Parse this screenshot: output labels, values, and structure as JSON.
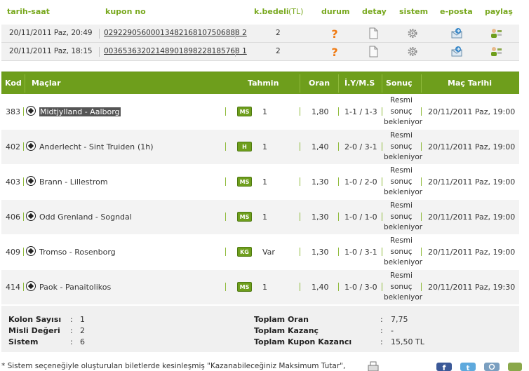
{
  "coupons": {
    "headers": {
      "datetime": "tarih-saat",
      "coupon_no": "kupon no",
      "stake": "k.bedeli",
      "currency": "(TL)",
      "status": "durum",
      "detail": "detay",
      "system": "sistem",
      "email": "e-posta",
      "share": "paylaş"
    },
    "rows": [
      {
        "datetime": "20/11/2011 Paz, 20:49",
        "coupon_no": "02922905600013482168107506888 2",
        "stake": "2",
        "status_icon": "question-icon"
      },
      {
        "datetime": "20/11/2011 Paz, 18:15",
        "coupon_no": "00365363202148901898228185768 1",
        "stake": "2",
        "status_icon": "question-icon"
      }
    ]
  },
  "matches": {
    "headers": {
      "code": "Kod",
      "matches": "Maçlar",
      "prediction": "Tahmin",
      "odds": "Oran",
      "iyms": "İ.Y/M.S",
      "result": "Sonuç",
      "date": "Maç Tarihi"
    },
    "rows": [
      {
        "code": "383",
        "match": "Midtjylland - Aalborg",
        "extra": "",
        "bet_type": "MS",
        "prediction": "1",
        "odds": "1,80",
        "iyms": "1-1 / 1-3",
        "result_lines": [
          "Resmi",
          "sonuç",
          "bekleniyor"
        ],
        "date": "20/11/2011 Paz, 19:00"
      },
      {
        "code": "402",
        "match": "Anderlecht - Sint Truiden",
        "extra": "(1h)",
        "bet_type": "H",
        "prediction": "1",
        "odds": "1,40",
        "iyms": "2-0 / 3-1",
        "result_lines": [
          "Resmi",
          "sonuç",
          "bekleniyor"
        ],
        "date": "20/11/2011 Paz, 19:00"
      },
      {
        "code": "403",
        "match": "Brann - Lillestrom",
        "extra": "",
        "bet_type": "MS",
        "prediction": "1",
        "odds": "1,30",
        "iyms": "1-0 / 2-0",
        "result_lines": [
          "Resmi",
          "sonuç",
          "bekleniyor"
        ],
        "date": "20/11/2011 Paz, 19:00"
      },
      {
        "code": "406",
        "match": "Odd Grenland - Sogndal",
        "extra": "",
        "bet_type": "MS",
        "prediction": "1",
        "odds": "1,30",
        "iyms": "1-0 / 1-0",
        "result_lines": [
          "Resmi",
          "sonuç",
          "bekleniyor"
        ],
        "date": "20/11/2011 Paz, 19:00"
      },
      {
        "code": "409",
        "match": "Tromso - Rosenborg",
        "extra": "",
        "bet_type": "KG",
        "prediction": "Var",
        "odds": "1,30",
        "iyms": "1-0 / 3-1",
        "result_lines": [
          "Resmi",
          "sonuç",
          "bekleniyor"
        ],
        "date": "20/11/2011 Paz, 19:00"
      },
      {
        "code": "414",
        "match": "Paok - Panaitolikos",
        "extra": "",
        "bet_type": "MS",
        "prediction": "1",
        "odds": "1,40",
        "iyms": "1-0 / 3-0",
        "result_lines": [
          "Resmi",
          "sonuç",
          "bekleniyor"
        ],
        "date": "20/11/2011 Paz, 19:30"
      }
    ]
  },
  "summary": {
    "column_count_label": "Kolon Sayısı",
    "column_count": "1",
    "multiplier_label": "Misli Değeri",
    "multiplier": "2",
    "system_label": "Sistem",
    "system": "6",
    "total_odds_label": "Toplam Oran",
    "total_odds": "7,75",
    "total_win_label": "Toplam Kazanç",
    "total_win": "-",
    "total_coupon_win_label": "Toplam Kupon Kazancı",
    "total_coupon_win": "15,50 TL",
    "colon": ":"
  },
  "footnote": "* Sistem seçeneğiyle oluşturulan biletlerde kesinleşmiş \"Kazanabileceğiniz Maksimum Tutar\",",
  "colors": {
    "accent_green": "#6e9e1c",
    "header_text_green": "#78a81e",
    "status_orange": "#f07a12",
    "handicap_red": "#c0201e"
  }
}
